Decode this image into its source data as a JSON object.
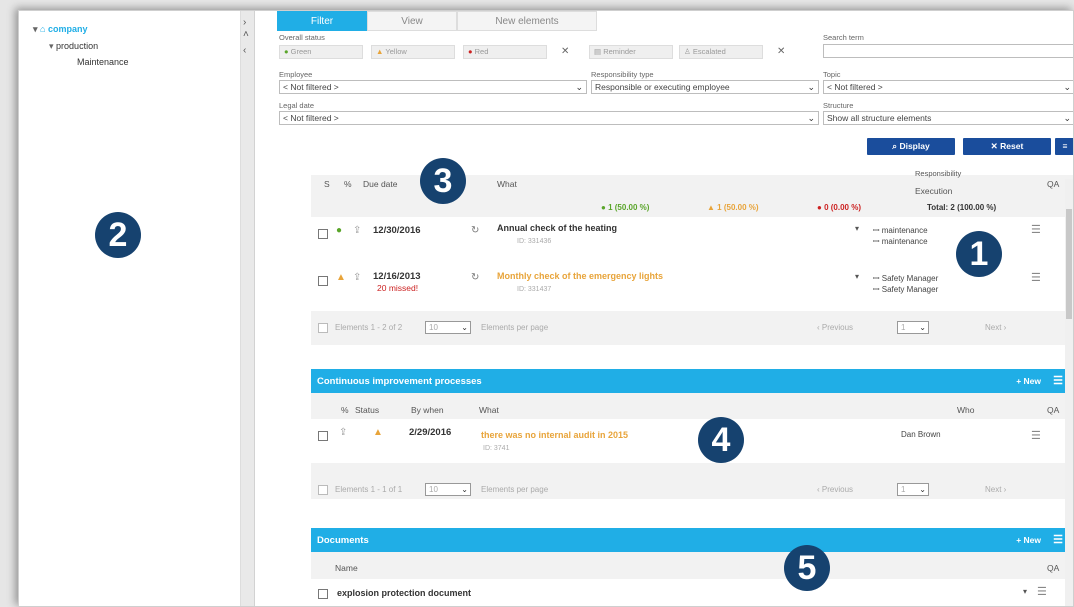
{
  "tree": {
    "root": "company",
    "child": "production",
    "leaf": "Maintenance"
  },
  "tabs": [
    "Filter",
    "View",
    "New elements"
  ],
  "filter": {
    "overall_status_label": "Overall status",
    "chips": [
      "Green",
      "Yellow",
      "Red",
      "Reminder",
      "Escalated"
    ],
    "search_label": "Search term",
    "employee_label": "Employee",
    "employee_value": "< Not filtered >",
    "resp_label": "Responsibility type",
    "resp_value": "Responsible or executing employee",
    "topic_label": "Topic",
    "topic_value": "< Not filtered >",
    "legal_label": "Legal date",
    "legal_value": "< Not filtered >",
    "structure_label": "Structure",
    "structure_value": "Show all structure elements",
    "display_button": "Display",
    "reset_button": "Reset"
  },
  "tasks": {
    "headers": {
      "s": "S",
      "pct": "%",
      "due": "Due date",
      "what": "What",
      "resp": "Responsibility",
      "exec": "Execution",
      "qa": "QA"
    },
    "summary": {
      "green": "1 (50.00 %)",
      "yellow": "1 (50.00 %)",
      "red": "0 (0.00 %)",
      "total": "Total: 2 (100.00 %)"
    },
    "rows": [
      {
        "date": "12/30/2016",
        "missed": "",
        "what": "Annual check of the heating",
        "id": "ID: 331436",
        "who1": "maintenance",
        "who2": "maintenance"
      },
      {
        "date": "12/16/2013",
        "missed": "20 missed!",
        "what": "Monthly check of the emergency lights",
        "id": "ID: 331437",
        "who1": "Safety Manager",
        "who2": "Safety Manager"
      }
    ],
    "pager": {
      "elements": "Elements 1 - 2 of 2",
      "per_page": "10",
      "per_page_label": "Elements per page",
      "previous": "Previous",
      "page": "1",
      "next": "Next"
    }
  },
  "cip": {
    "title": "Continuous improvement processes",
    "new": "New",
    "headers": {
      "pct": "%",
      "status": "Status",
      "by_when": "By when",
      "what": "What",
      "who": "Who",
      "qa": "QA"
    },
    "rows": [
      {
        "date": "2/29/2016",
        "what": "there was no internal audit in 2015",
        "id": "ID: 3741",
        "who": "Dan Brown"
      }
    ],
    "pager": {
      "elements": "Elements 1 - 1 of 1",
      "per_page": "10",
      "per_page_label": "Elements per page",
      "previous": "Previous",
      "page": "1",
      "next": "Next"
    }
  },
  "documents": {
    "title": "Documents",
    "new": "New",
    "headers": {
      "name": "Name",
      "qa": "QA"
    },
    "rows": [
      {
        "name": "explosion protection document"
      }
    ]
  },
  "badges": [
    "1",
    "2",
    "3",
    "4",
    "5"
  ],
  "colors": {
    "accent": "#20aee6",
    "button": "#1a4d9c",
    "badge": "#16426f",
    "green": "#5aa52a",
    "yellow": "#e8a43a",
    "red": "#cc2222"
  }
}
